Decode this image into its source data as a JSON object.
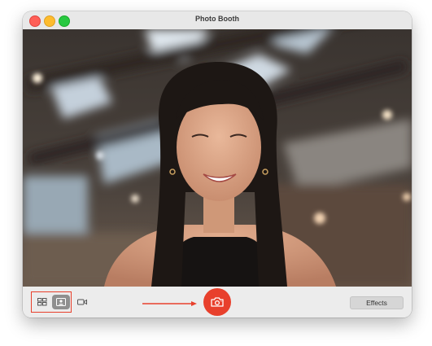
{
  "window": {
    "title": "Photo Booth"
  },
  "toolbar": {
    "effects_label": "Effects",
    "layout_modes": [
      {
        "name": "four-up",
        "icon": "grid-icon",
        "selected": false
      },
      {
        "name": "single-photo",
        "icon": "person-photo-icon",
        "selected": true
      },
      {
        "name": "video",
        "icon": "video-camera-icon",
        "selected": false
      }
    ],
    "shutter_icon": "camera-icon"
  },
  "colors": {
    "shutter": "#e8402c",
    "annotation": "#e8402c",
    "selected_mode": "#8f8f8f"
  }
}
